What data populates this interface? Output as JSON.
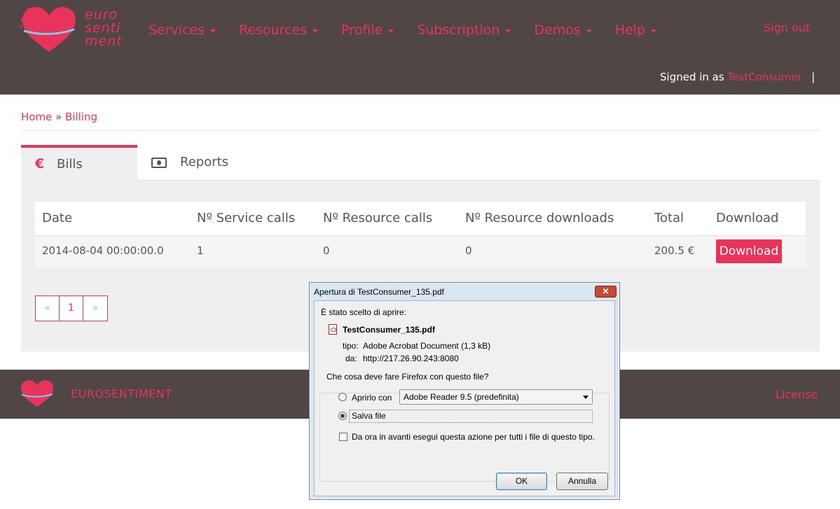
{
  "brand": {
    "logo_lines": [
      "euro",
      "senti",
      "ment"
    ],
    "footer_name": "EUROSENTIMENT",
    "color": "#e8335a"
  },
  "nav": {
    "items": [
      "Services",
      "Resources",
      "Profile",
      "Subscription",
      "Demos",
      "Help"
    ],
    "sign_out": "Sign out",
    "signed_in_prefix": "Signed in as",
    "username": "TestConsumer",
    "separator": "|"
  },
  "breadcrumb": {
    "home": "Home",
    "sep": "»",
    "current": "Billing"
  },
  "tabs": {
    "bills": {
      "label": "Bills",
      "icon": "€"
    },
    "reports": {
      "label": "Reports",
      "icon": "money-icon"
    }
  },
  "table": {
    "headers": [
      "Date",
      "Nº Service calls",
      "Nº Resource calls",
      "Nº Resource downloads",
      "Total",
      "Download"
    ],
    "rows": [
      {
        "date": "2014-08-04 00:00:00.0",
        "service_calls": "1",
        "resource_calls": "0",
        "resource_downloads": "0",
        "total": "200.5 €",
        "download_label": "Download"
      }
    ]
  },
  "pagination": {
    "prev": "«",
    "page": "1",
    "next": "»"
  },
  "footer": {
    "license": "License"
  },
  "dialog": {
    "title": "Apertura di TestConsumer_135.pdf",
    "close": "✕",
    "intro": "È stato scelto di aprire:",
    "filename": "TestConsumer_135.pdf",
    "type_label": "tipo:",
    "type_value": "Adobe Acrobat Document (1,3 kB)",
    "from_label": "da:",
    "from_value": "http://217.26.90.243:8080",
    "question": "Che cosa deve fare Firefox con questo file?",
    "open_with_label": "Aprirlo con",
    "open_with_app": "Adobe Reader 9.5 (predefinita)",
    "save_label": "Salva file",
    "remember_label": "Da ora in avanti esegui questa azione per tutti i file di questo tipo.",
    "ok": "OK",
    "cancel": "Annulla",
    "selected_option": "save"
  }
}
